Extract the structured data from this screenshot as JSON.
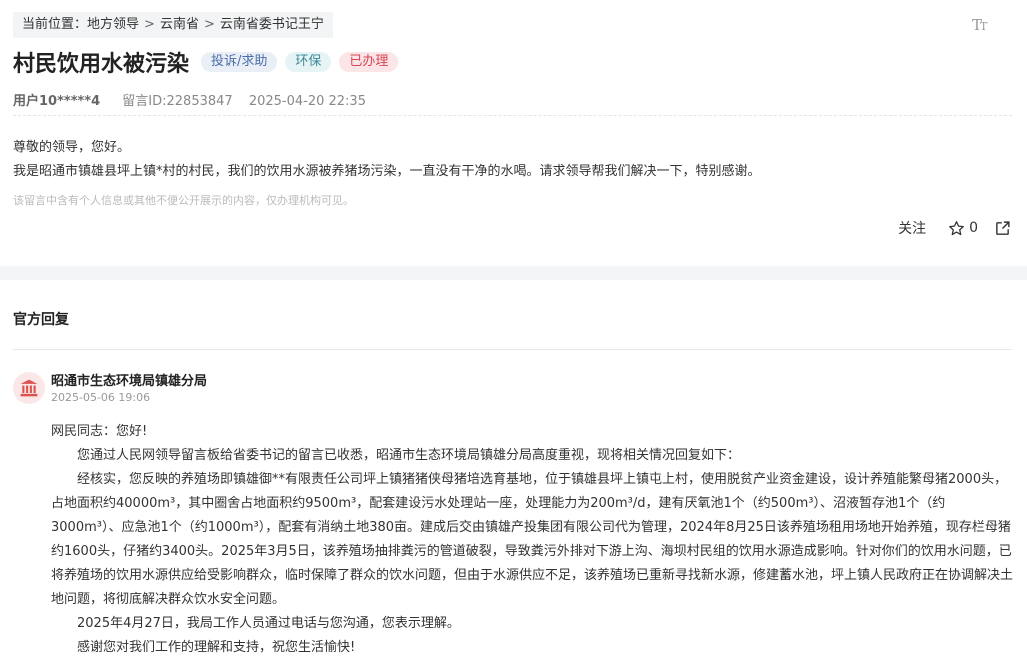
{
  "breadcrumb": {
    "prefix": "当前位置：",
    "items": [
      "地方领导",
      "云南省",
      "云南省委书记王宁"
    ],
    "separator": ">"
  },
  "font_toggle": {
    "large": "T",
    "small": "T"
  },
  "message": {
    "title": "村民饮用水被污染",
    "tags": [
      {
        "label": "投诉/求助",
        "color": "#4a6fa8"
      },
      {
        "label": "环保",
        "color": "#3b8a99"
      },
      {
        "label": "已办理",
        "color": "#d84454"
      }
    ],
    "user": "用户10*****4",
    "message_id": "留言ID:22853847",
    "datetime": "2025-04-20 22:35",
    "greeting": "尊敬的领导，您好。",
    "body": "我是昭通市镇雄县坪上镇*村的村民，我们的饮用水源被养猪场污染，一直没有干净的水喝。请求领导帮我们解决一下，特别感谢。",
    "privacy_note": "该留言中含有个人信息或其他不便公开展示的内容，仅办理机构可见。"
  },
  "actions": {
    "follow_label": "关注",
    "star_count": "0",
    "star_icon": "star-icon",
    "share_icon": "share-icon"
  },
  "official_reply": {
    "section_title": "官方回复",
    "org_name": "昭通市生态环境局镇雄分局",
    "org_icon": "government-building-icon",
    "datetime": "2025-05-06 19:06",
    "paragraphs": [
      "网民同志：您好!",
      "您通过人民网领导留言板给省委书记的留言已收悉，昭通市生态环境局镇雄分局高度重视，现将相关情况回复如下：",
      "经核实，您反映的养殖场即镇雄御**有限责任公司坪上镇猪猪侠母猪培选育基地，位于镇雄县坪上镇屯上村，使用脱贫产业资金建设，设计养殖能繁母猪2000头，占地面积约40000m³，其中圈舍占地面积约9500m³，配套建设污水处理站一座，处理能力为200m³/d，建有厌氧池1个（约500m³）、沼液暂存池1个（约3000m³）、应急池1个（约1000m³），配套有消纳土地380亩。建成后交由镇雄产投集团有限公司代为管理，2024年8月25日该养殖场租用场地开始养殖，现存栏母猪约1600头，仔猪约3400头。2025年3月5日，该养殖场抽排粪污的管道破裂，导致粪污外排对下游上沟、海坝村民组的饮用水源造成影响。针对你们的饮用水问题，已将养殖场的饮用水源供应给受影响群众，临时保障了群众的饮水问题，但由于水源供应不足，该养殖场已重新寻找新水源，修建蓄水池，坪上镇人民政府正在协调解决土地问题，将彻底解决群众饮水安全问题。",
      "2025年4月27日，我局工作人员通过电话与您沟通，您表示理解。",
      "感谢您对我们工作的理解和支持，祝您生活愉快!"
    ]
  }
}
